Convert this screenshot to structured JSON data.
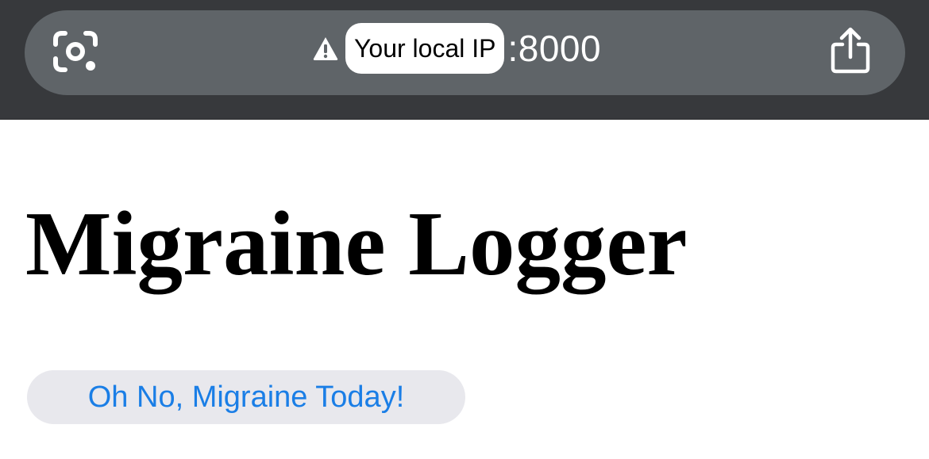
{
  "browser": {
    "address_highlight": "Your local IP",
    "address_port": ":8000",
    "icons": {
      "left": "camera-lens-icon",
      "security": "warning-icon",
      "right": "share-icon"
    },
    "colors": {
      "chrome_background": "#37393c",
      "url_bar": "#5f6468"
    }
  },
  "page": {
    "title": "Migraine Logger",
    "button_label": "Oh No, Migraine Today!",
    "colors": {
      "button_background": "#e8e8ed",
      "button_text": "#1a7ee6"
    }
  }
}
